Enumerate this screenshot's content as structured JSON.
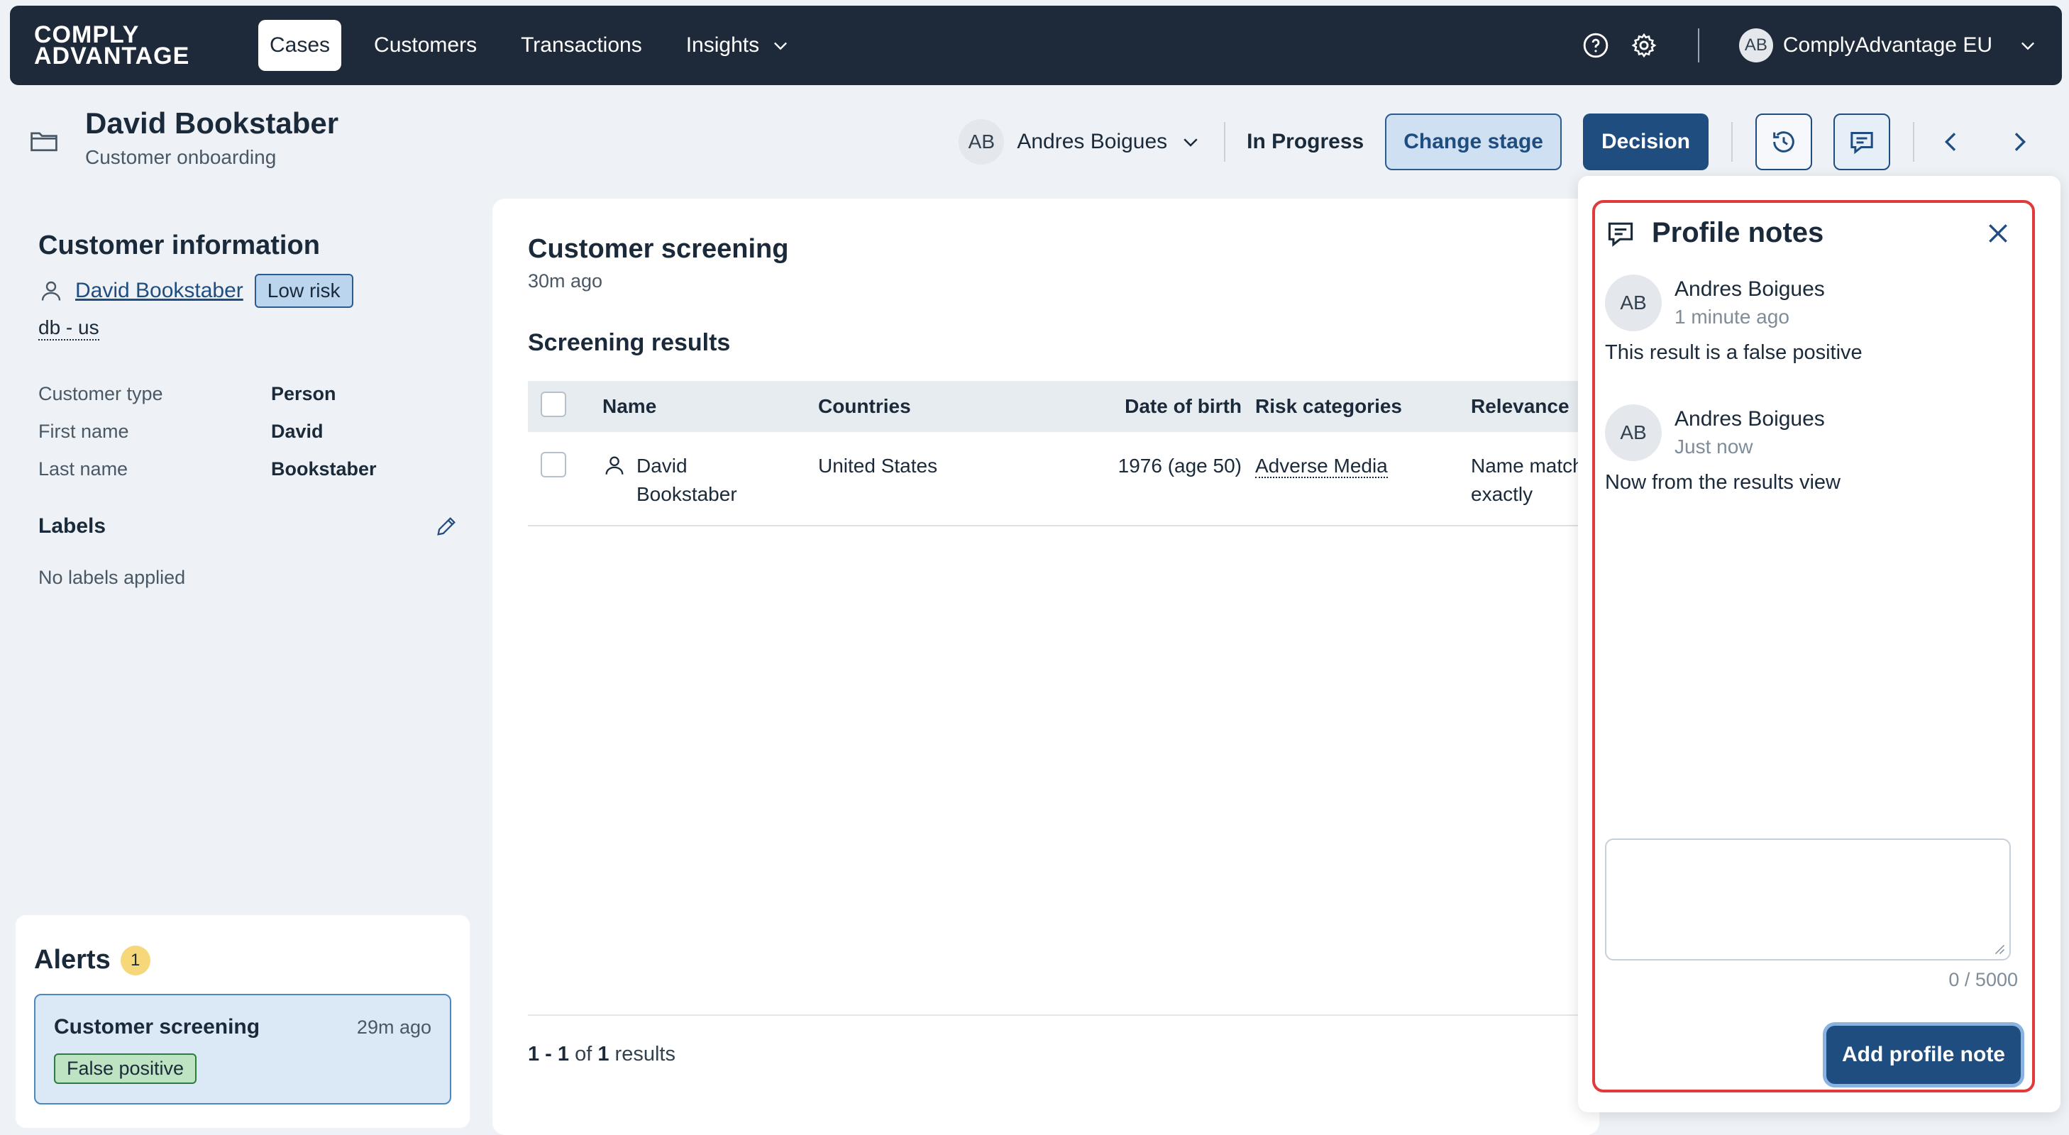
{
  "brand": {
    "line1": "COMPLY",
    "line2": "ADVANTAGE"
  },
  "nav": {
    "tabs": [
      {
        "label": "Cases"
      },
      {
        "label": "Customers"
      },
      {
        "label": "Transactions"
      },
      {
        "label": "Insights"
      }
    ],
    "org": {
      "initials": "AB",
      "name": "ComplyAdvantage EU"
    }
  },
  "case": {
    "title": "David Bookstaber",
    "subtitle": "Customer onboarding",
    "assignee": {
      "initials": "AB",
      "name": "Andres Boigues"
    },
    "status": "In Progress",
    "change_stage_label": "Change stage",
    "decision_label": "Decision"
  },
  "customer_info": {
    "title": "Customer information",
    "name": "David Bookstaber",
    "risk": "Low risk",
    "source": "db - us",
    "fields": [
      {
        "label": "Customer type",
        "value": "Person"
      },
      {
        "label": "First name",
        "value": "David"
      },
      {
        "label": "Last name",
        "value": "Bookstaber"
      }
    ],
    "labels_title": "Labels",
    "labels_empty": "No labels applied"
  },
  "alerts": {
    "title": "Alerts",
    "count": "1",
    "items": [
      {
        "title": "Customer screening",
        "time": "29m ago",
        "status": "False positive"
      }
    ]
  },
  "screening": {
    "title": "Customer screening",
    "time": "30m ago",
    "results_title": "Screening results",
    "columns": [
      "Name",
      "Countries",
      "Date of birth",
      "Risk categories",
      "Relevance"
    ],
    "rows": [
      {
        "name_line1": "David",
        "name_line2": "Bookstaber",
        "countries": "United States",
        "dob": "1976 (age 50)",
        "risk": "Adverse Media",
        "relevance_line1": "Name match",
        "relevance_line2": "exactly"
      }
    ],
    "pager": {
      "range": "1 - 1",
      "of": "of",
      "total": "1",
      "suffix": "results"
    }
  },
  "notes": {
    "title": "Profile notes",
    "items": [
      {
        "initials": "AB",
        "author": "Andres Boigues",
        "time": "1 minute ago",
        "text": "This result is a false positive"
      },
      {
        "initials": "AB",
        "author": "Andres Boigues",
        "time": "Just now",
        "text": "Now from the results view"
      }
    ],
    "input_value": "",
    "counter": "0 / 5000",
    "add_label": "Add profile note"
  }
}
